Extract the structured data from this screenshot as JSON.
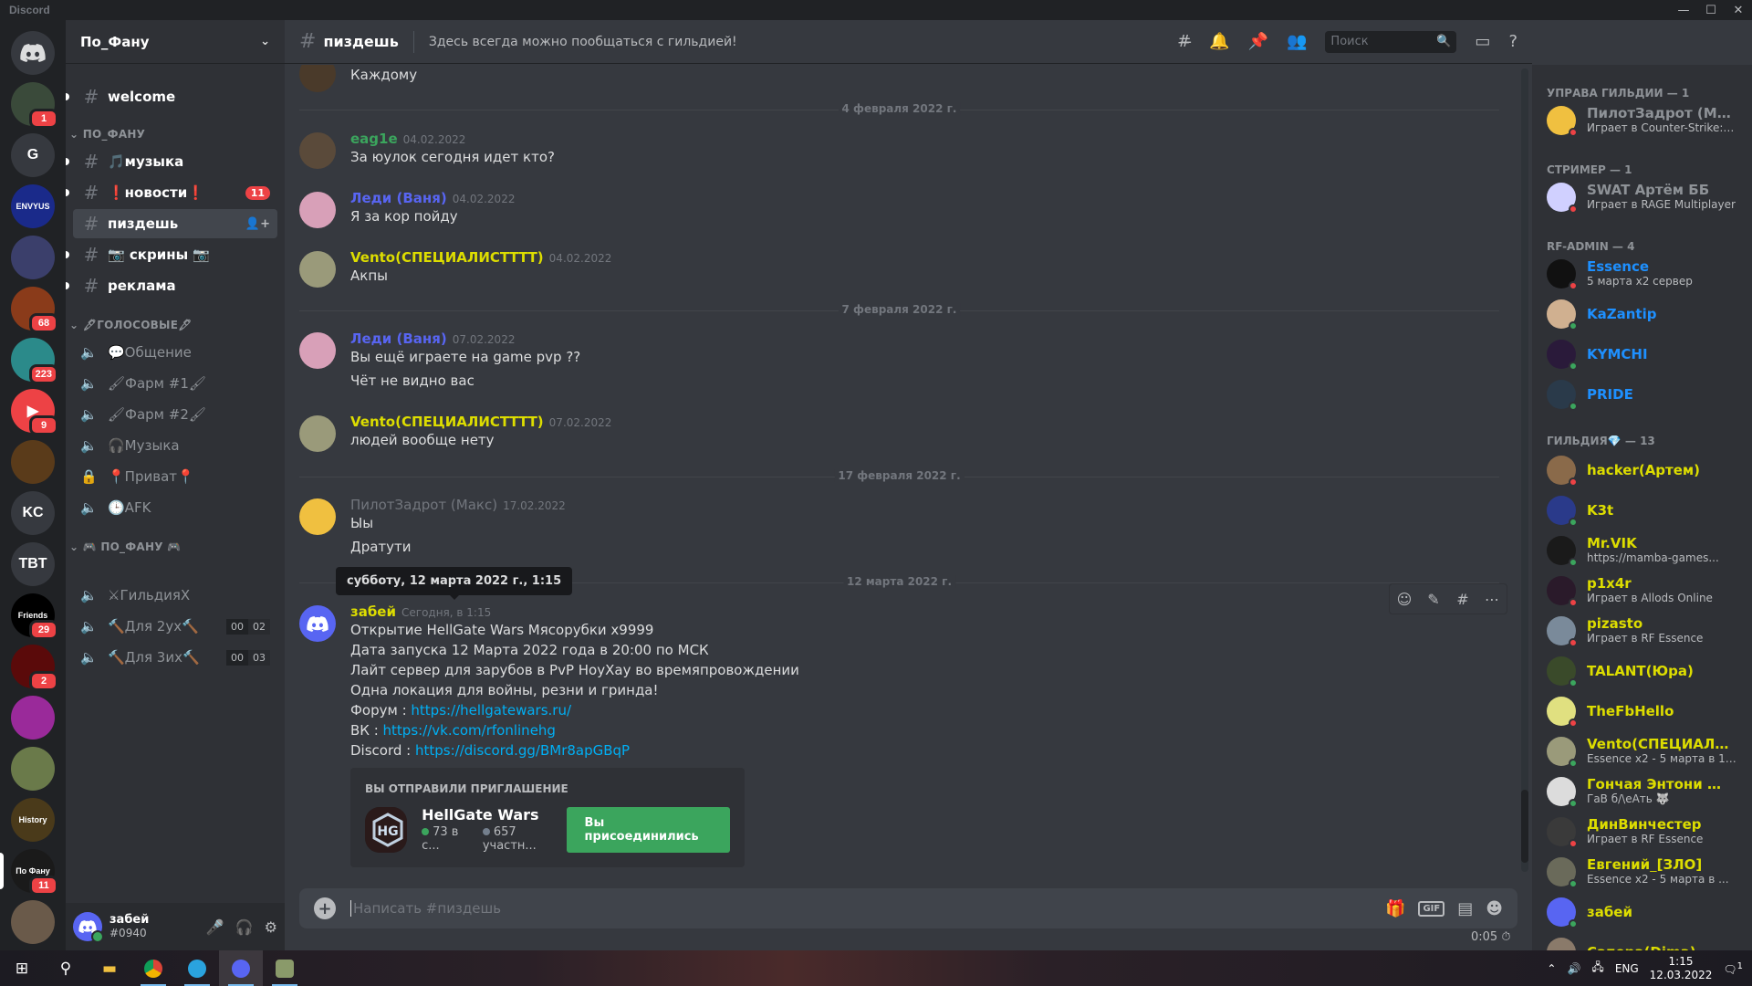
{
  "window": {
    "app_title": "Discord",
    "minimize": "—",
    "maximize": "☐",
    "close": "✕"
  },
  "rail": {
    "home_label": "Discord",
    "servers": [
      {
        "kind": "img",
        "color": "#3a4a3a",
        "badge": "1"
      },
      {
        "kind": "text",
        "text": "G",
        "color": "#36393f"
      },
      {
        "kind": "img",
        "color": "#1a2a8a",
        "label": "ENVYUS"
      },
      {
        "kind": "img",
        "color": "#3b3f6b"
      },
      {
        "kind": "img",
        "color": "#8a3b1a",
        "badge": "68"
      },
      {
        "kind": "img",
        "color": "#2b8a8a",
        "badge": "223"
      },
      {
        "kind": "img",
        "color": "#ed4245",
        "badge": "9",
        "glyph": "▶"
      },
      {
        "kind": "img",
        "color": "#5a3b1a"
      },
      {
        "kind": "text",
        "text": "KC",
        "color": "#36393f"
      },
      {
        "kind": "text",
        "text": "TBT",
        "color": "#36393f"
      },
      {
        "kind": "img",
        "color": "#000000",
        "badge": "29",
        "label": "Friends"
      },
      {
        "kind": "img",
        "color": "#5a0a0a",
        "badge": "2"
      },
      {
        "kind": "img",
        "color": "#9a2a9a"
      },
      {
        "kind": "img",
        "color": "#6a7a4a"
      },
      {
        "kind": "img",
        "color": "#4a3a1a",
        "label": "History"
      },
      {
        "kind": "img",
        "color": "#1a1a1a",
        "badge": "11",
        "label": "По Фану"
      },
      {
        "kind": "img",
        "color": "#6a5a4a"
      }
    ]
  },
  "guild": {
    "name": "По_Фану",
    "chevron": "⌄",
    "top_channel": "welcome",
    "categories": [
      "ПО_ФАНУ",
      "🖋ГОЛОСОВЫЕ🖋",
      "🎮 ПО_ФАНУ 🎮"
    ],
    "text_channels": [
      {
        "name": "🎵музыка"
      },
      {
        "name": "❗новости❗",
        "mention": "11"
      },
      {
        "name": "пиздешь"
      },
      {
        "name": "📷 скрины 📷"
      },
      {
        "name": "реклама"
      }
    ],
    "voice_channels": [
      "💬Общение",
      "🖌Фарм #1🖌",
      "🖌Фарм #2🖌",
      "🎧Музыка",
      "📍Приват📍",
      "🕒AFK"
    ],
    "game_channels": [
      {
        "name": "⚔ГильдияⅩ"
      },
      {
        "name": "🔨Для 2ух🔨",
        "a": "00",
        "b": "02"
      },
      {
        "name": "🔨Для 3их🔨",
        "a": "00",
        "b": "03"
      }
    ]
  },
  "user": {
    "name": "забей",
    "tag": "#0940",
    "mic": "🎤",
    "headphones": "🎧",
    "settings": "⚙"
  },
  "channel": {
    "name": "пиздешь",
    "topic": "Здесь всегда можно пообщаться с гильдией!",
    "search_placeholder": "Поиск"
  },
  "messages": {
    "top_line": "Каждому",
    "dividers": [
      "4 февраля 2022 г.",
      "7 февраля 2022 г.",
      "17 февраля 2022 г.",
      "12 марта 2022 г."
    ],
    "m1": {
      "author": "eag1e",
      "time": "04.02.2022",
      "color": "#3ba55d",
      "lines": [
        "За юулок сегодня идет кто?"
      ]
    },
    "m2": {
      "author": "Леди (Ваня)",
      "time": "04.02.2022",
      "color": "#5865f2",
      "lines": [
        "Я за кор пойду"
      ]
    },
    "m3": {
      "author": "Vento(СПЕЦИАЛИСТТТТ)",
      "time": "04.02.2022",
      "color": "#dddd00",
      "lines": [
        "Акпы"
      ]
    },
    "m4": {
      "author": "Леди (Ваня)",
      "time": "07.02.2022",
      "color": "#5865f2",
      "lines": [
        "Вы ещё играете на game pvp ??",
        "Чёт не видно вас"
      ]
    },
    "m5": {
      "author": "Vento(СПЕЦИАЛИСТТТТ)",
      "time": "07.02.2022",
      "color": "#dddd00",
      "lines": [
        "людей вообще нету"
      ]
    },
    "m6": {
      "author": "ПилотЗадрот (Макс)",
      "time": "17.02.2022",
      "color": "#4f545c",
      "lines": [
        "Ыы",
        "Дратути"
      ]
    },
    "tooltip": "субботу, 12 марта 2022 г., 1:15",
    "m7": {
      "author": "забей",
      "time": "Сегодня, в 1:15",
      "color": "#dddd00",
      "l1": "Открытие HellGate Wars Мясорубки x9999",
      "l2": "Дата запуска 12 Марта 2022 года в 20:00 по МСК",
      "l3": "Лайт сервер для зарубов в PvP НоуХау во времяпровождении",
      "l4": "Одна локация для войны, резни и гринда!",
      "forum_label": "Форум : ",
      "forum_link": "https://hellgatewars.ru/",
      "vk_label": "ВК : ",
      "vk_link": "https://vk.com/rfonlinehg",
      "discord_label": "Discord : ",
      "discord_link": "https://discord.gg/BMr8apGBqP"
    },
    "invite": {
      "header": "ВЫ ОТПРАВИЛИ ПРИГЛАШЕНИЕ",
      "guild": "HellGate Wars",
      "online": "73 в с...",
      "members": "657 участн...",
      "button": "Вы присоединились"
    }
  },
  "composer": {
    "placeholder": "Написать #пиздешь",
    "gif": "GIF",
    "slowmode": "0:05 ⏱"
  },
  "members": {
    "groups": [
      {
        "title": "УПРАВА ГИЛЬДИИ — 1"
      },
      {
        "title": "СТРИМЕР — 1"
      },
      {
        "title": "RF-ADMIN — 4"
      },
      {
        "title": "ГИЛЬДИЯ💎 — 13"
      }
    ],
    "list": [
      {
        "name": "ПилотЗадрот (Макс)",
        "activity": "Играет в Counter-Strike: Glob...",
        "color": "#72767d",
        "status": "#ed4245",
        "avatar": "#f0c040",
        "offline": true
      },
      {
        "name": "SWAT Артём ББ",
        "activity": "Играет в RAGE Multiplayer",
        "color": "#9b59b6",
        "status": "#ed4245",
        "avatar": "#d0d0ff",
        "offline": true
      },
      {
        "name": "Essence",
        "activity": "5 марта x2 сервер",
        "color": "#1e90ff",
        "status": "#ed4245",
        "avatar": "#111111"
      },
      {
        "name": "KaZantip",
        "activity": "",
        "color": "#1e90ff",
        "status": "#3ba55d",
        "avatar": "#d0b090"
      },
      {
        "name": "KYMCHI",
        "activity": "",
        "color": "#1e90ff",
        "status": "#3ba55d",
        "avatar": "#2a1a3a"
      },
      {
        "name": "PRIDE",
        "activity": "",
        "color": "#1e90ff",
        "status": "#3ba55d",
        "avatar": "#2a3a4a"
      },
      {
        "name": "hacker(Артем)",
        "activity": "",
        "color": "#dddd00",
        "status": "#ed4245",
        "avatar": "#8a6a4a"
      },
      {
        "name": "K3t",
        "activity": "",
        "color": "#dddd00",
        "status": "#3ba55d",
        "avatar": "#2a3a8a"
      },
      {
        "name": "Mr.VIK",
        "activity": "https://mamba-games...",
        "color": "#dddd00",
        "status": "#3ba55d",
        "avatar": "#1a1a1a"
      },
      {
        "name": "p1x4r",
        "activity": "Играет в Allods Online",
        "color": "#dddd00",
        "status": "#ed4245",
        "avatar": "#2a1a2a"
      },
      {
        "name": "pizasto",
        "activity": "Играет в RF Essence",
        "color": "#dddd00",
        "status": "#ed4245",
        "avatar": "#7a8a9a"
      },
      {
        "name": "TALANT(Юра)",
        "activity": "",
        "color": "#dddd00",
        "status": "#3ba55d",
        "avatar": "#3a4a2a"
      },
      {
        "name": "TheFbHello",
        "activity": "",
        "color": "#dddd00",
        "status": "#ed4245",
        "avatar": "#e0e080"
      },
      {
        "name": "Vento(СПЕЦИАЛИСТ...",
        "activity": "Essence x2 - 5 марта в 18:00!",
        "color": "#dddd00",
        "status": "#3ba55d",
        "avatar": "#9a9a7a"
      },
      {
        "name": "Гончая Энтони 🐺 Big...",
        "activity": "ГаВ б/\\еАть 🐺",
        "color": "#dddd00",
        "status": "#3ba55d",
        "avatar": "#dcdcdc"
      },
      {
        "name": "ДинВинчестер",
        "activity": "Играет в RF Essence",
        "color": "#dddd00",
        "status": "#ed4245",
        "avatar": "#3a3a3a"
      },
      {
        "name": "Евгений_[ЗЛО]",
        "activity": "Essence x2 - 5 марта в ...",
        "color": "#dddd00",
        "status": "#3ba55d",
        "avatar": "#6a6a5a"
      },
      {
        "name": "забей",
        "activity": "",
        "color": "#dddd00",
        "status": "#3ba55d",
        "avatar": "#5865f2"
      },
      {
        "name": "Сапера(Dima)",
        "activity": "",
        "color": "#dddd00",
        "status": "#3ba55d",
        "avatar": "#8a7a6a"
      }
    ]
  },
  "taskbar": {
    "lang": "ENG",
    "time": "1:15",
    "date": "12.03.2022",
    "notif": "1"
  }
}
